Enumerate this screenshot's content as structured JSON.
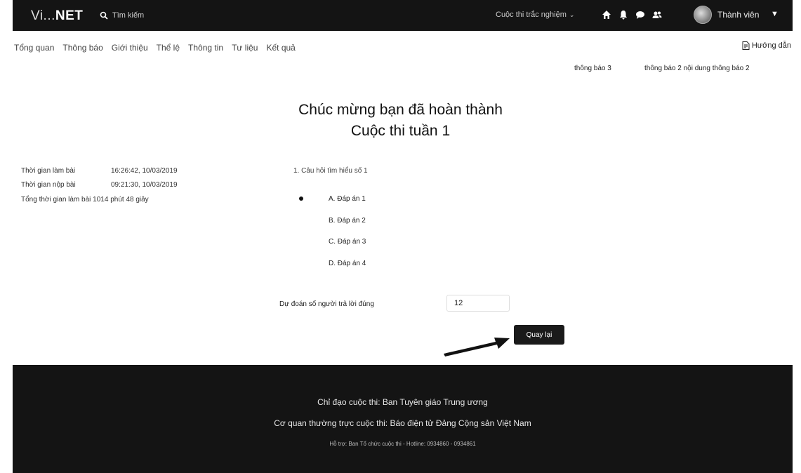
{
  "header": {
    "logo_prefix": "Vi...",
    "logo_bold": "NET",
    "search_placeholder": "Tìm kiếm",
    "contest_menu": "Cuộc thi trắc nghiệm",
    "member_label": "Thành viên",
    "icons": [
      "home-icon",
      "bell-icon",
      "chat-icon",
      "users-icon"
    ]
  },
  "nav": {
    "tabs": [
      "Tổng quan",
      "Thông báo",
      "Giới thiệu",
      "Thể lệ",
      "Thông tin",
      "Tư liệu",
      "Kết quả"
    ],
    "guide": "Hướng dẫn"
  },
  "notices": [
    "thông báo 3",
    "thông báo 2 nội dung thông báo 2"
  ],
  "result": {
    "title_line1": "Chúc mừng bạn đã hoàn thành",
    "title_line2": "Cuộc thi tuần 1"
  },
  "info": {
    "start_label": "Thời gian làm bài",
    "start_value": "16:26:42, 10/03/2019",
    "submit_label": "Thời gian nộp bài",
    "submit_value": "09:21:30, 10/03/2019",
    "total_label": "Tổng thời gian làm bài",
    "total_value": "1014 phút 48 giây"
  },
  "question": {
    "text": "1. Câu hỏi tìm hiểu số 1",
    "options": [
      "A. Đáp án 1",
      "B. Đáp án 2",
      "C. Đáp án 3",
      "D. Đáp án 4"
    ],
    "selected_index": 0
  },
  "prediction": {
    "label": "Dự đoán số người trả lời đúng",
    "value": "12"
  },
  "back_button": "Quay lại",
  "footer": {
    "line1": "Chỉ đạo cuộc thi: Ban Tuyên giáo Trung ương",
    "line2": "Cơ quan thường trực cuộc thi: Báo điện tử Đảng Cộng sản Việt Nam",
    "line3": "Hỗ trợ: Ban Tổ chức cuộc thi - Hotline: 0934860 - 0934861"
  }
}
